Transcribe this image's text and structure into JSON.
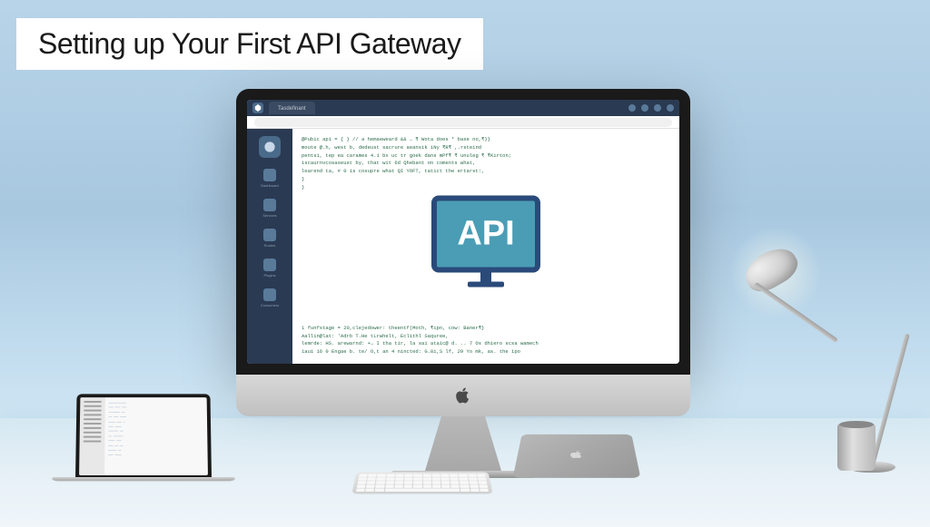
{
  "title": "Setting up Your First API Gateway",
  "imac_browser": {
    "tab_label": "Tasdefinant",
    "header_icons": [
      "notification-icon",
      "help-icon",
      "settings-icon",
      "user-icon"
    ],
    "sidebar": {
      "logo_label": "logo",
      "items": [
        {
          "label": "Dashboard"
        },
        {
          "label": "Services"
        },
        {
          "label": "Routes"
        },
        {
          "label": "Plugins"
        },
        {
          "label": "Consumers"
        }
      ]
    },
    "api_icon_label": "API",
    "code_top": [
      "@Pubic api = { } // a hemaeweard && … ₹ Wota does * base no,₹}}",
      "moute @.h,  west b, dedeust sacrure aeansik iNy ₹R₹ ,.rsteind",
      "pentsi, tep ea carames 4.1 bx uc tr   goek dans mPf₹ ₹ unuleg    ₹  ₹Kirton;",
      "iscaurnvcosaseust by, that wit 6d  Qhebant on coments what,",
      "learend ta,  # 0 is cosupre   what QI  YOFT, tatict the ertarst:,",
      "}",
      "}"
    ],
    "code_bottom": [
      "1 funfstage = 20,clejedower: theentf(Moth, ₹ipn, cow: Baner₹}",
      "Aallin@lat:  'Adrb T.He tLrwhelt, Eclithl Saquree,",
      "lemrde: HS.  arewarnd:  +→ I tha  tir,   la sai ataic@  d. ..  7 Os dhiero  scsa wamech",
      "1aui 16 0 Engae b. te/ O,t an 4 nincted: G.8i,S lf, 29  Yo mk, as. the ipo"
    ]
  },
  "laptop": {
    "sidebar_lines": 10,
    "content_lines": 14
  },
  "colors": {
    "sidebar_bg": "#2a3a52",
    "api_fill": "#4a9db5",
    "api_border": "#2a4a7a"
  }
}
